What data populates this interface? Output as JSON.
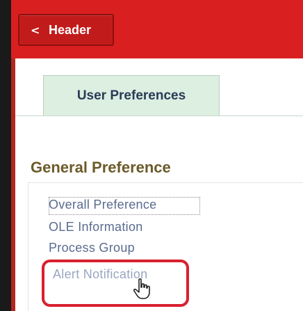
{
  "header": {
    "back_label": "Header"
  },
  "tabs": [
    {
      "label": "User Preferences",
      "active": true
    }
  ],
  "section": {
    "title": "General Preference"
  },
  "preferences": {
    "items": [
      {
        "label": "Overall Preference"
      },
      {
        "label": "OLE Information"
      },
      {
        "label": "Process Group"
      },
      {
        "label": "Alert Notification"
      }
    ]
  },
  "colors": {
    "header_red": "#d91f1f",
    "tab_green": "#dcefe1",
    "section_title": "#6b5a2a",
    "link": "#5a6b8f",
    "highlight": "#d9202f"
  },
  "icons": {
    "back": "chevron-left-icon",
    "cursor": "hand-pointer-icon"
  }
}
